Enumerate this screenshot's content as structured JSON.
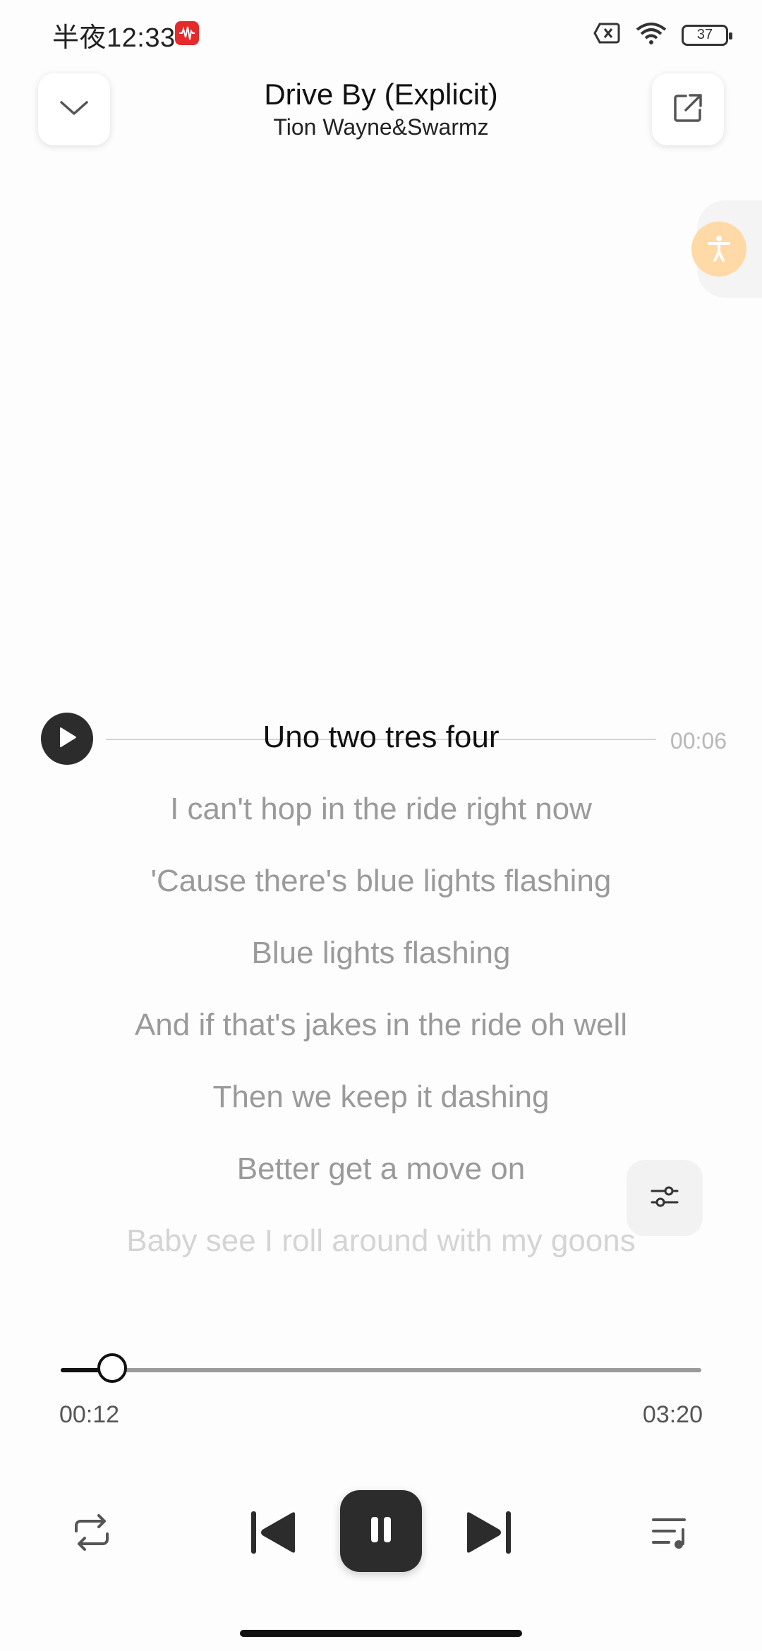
{
  "status_bar": {
    "time": "半夜12:33",
    "battery_level": "37"
  },
  "header": {
    "title": "Drive By (Explicit)",
    "artist": "Tion Wayne&Swarmz"
  },
  "lyrics": {
    "current": {
      "text": "Uno two tres four",
      "timestamp": "00:06"
    },
    "lines": [
      "I can't hop in the ride right now",
      "'Cause there's blue lights flashing",
      "Blue lights flashing",
      "And if that's jakes in the ride oh well",
      "Then we keep it dashing",
      "Better get a move on",
      "Baby see I roll around with my goons"
    ]
  },
  "progress": {
    "elapsed": "00:12",
    "duration": "03:20",
    "fraction": 0.08
  },
  "colors": {
    "accent_dark": "#2c2c2c",
    "lyric_inactive": "#9a9a9a",
    "accessibility": "#ffd9a6",
    "app_badge": "#e32b2b"
  },
  "icons": {
    "collapse": "chevron-down-icon",
    "share": "share-icon",
    "accessibility": "accessibility-icon",
    "equalizer": "equalizer-icon",
    "repeat": "repeat-icon",
    "previous": "previous-icon",
    "pause": "pause-icon",
    "next": "next-icon",
    "queue": "queue-icon"
  }
}
